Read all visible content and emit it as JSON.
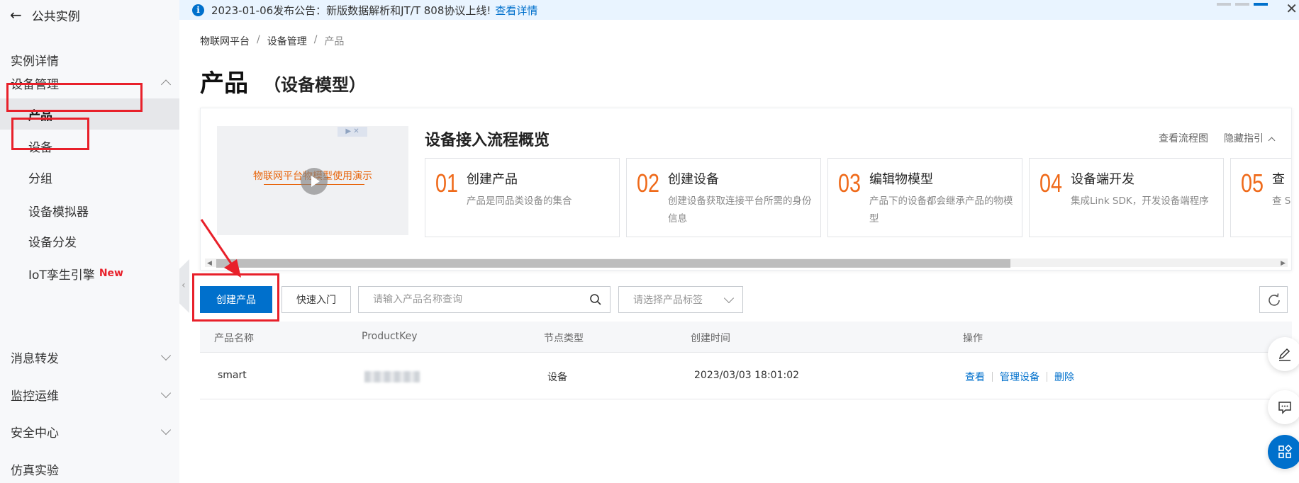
{
  "sidebar": {
    "header": "公共实例",
    "items": [
      {
        "label": "实例详情"
      },
      {
        "label": "设备管理"
      },
      {
        "label": "产品"
      },
      {
        "label": "设备"
      },
      {
        "label": "分组"
      },
      {
        "label": "设备模拟器"
      },
      {
        "label": "设备分发"
      },
      {
        "label": "IoT孪生引擎",
        "badge": "New"
      },
      {
        "label": "消息转发"
      },
      {
        "label": "监控运维"
      },
      {
        "label": "安全中心"
      },
      {
        "label": "仿真实验"
      }
    ]
  },
  "announcement": {
    "text": "2023-01-06发布公告：新版数据解析和JT/T 808协议上线!",
    "link": "查看详情"
  },
  "breadcrumb": [
    "物联网平台",
    "设备管理",
    "产品"
  ],
  "page": {
    "title": "产品",
    "subtitle": "（设备模型）"
  },
  "overview": {
    "video_caption": "物联网平台物模型使用演示",
    "title": "设备接入流程概览",
    "view_flow": "查看流程图",
    "hide_guide": "隐藏指引",
    "steps": [
      {
        "num": "01",
        "title": "创建产品",
        "desc": "产品是同品类设备的集合"
      },
      {
        "num": "02",
        "title": "创建设备",
        "desc": "创建设备获取连接平台所需的身份信息"
      },
      {
        "num": "03",
        "title": "编辑物模型",
        "desc": "产品下的设备都会继承产品的物模型"
      },
      {
        "num": "04",
        "title": "设备端开发",
        "desc": "集成Link SDK，开发设备端程序"
      },
      {
        "num": "05",
        "title": "查",
        "desc": "查 SD"
      }
    ]
  },
  "toolbar": {
    "create": "创建产品",
    "quick_start": "快速入门",
    "search_placeholder": "请输入产品名称查询",
    "tag_placeholder": "请选择产品标签"
  },
  "table": {
    "headers": [
      "产品名称",
      "ProductKey",
      "节点类型",
      "创建时间",
      "操作"
    ],
    "rows": [
      {
        "name": "smart",
        "node_type": "设备",
        "created": "2023/03/03 18:01:02",
        "actions": [
          "查看",
          "管理设备",
          "删除"
        ]
      }
    ]
  },
  "colors": {
    "primary": "#0070cc",
    "step_number": "#ef6a1a",
    "annotation": "#e8202a"
  }
}
